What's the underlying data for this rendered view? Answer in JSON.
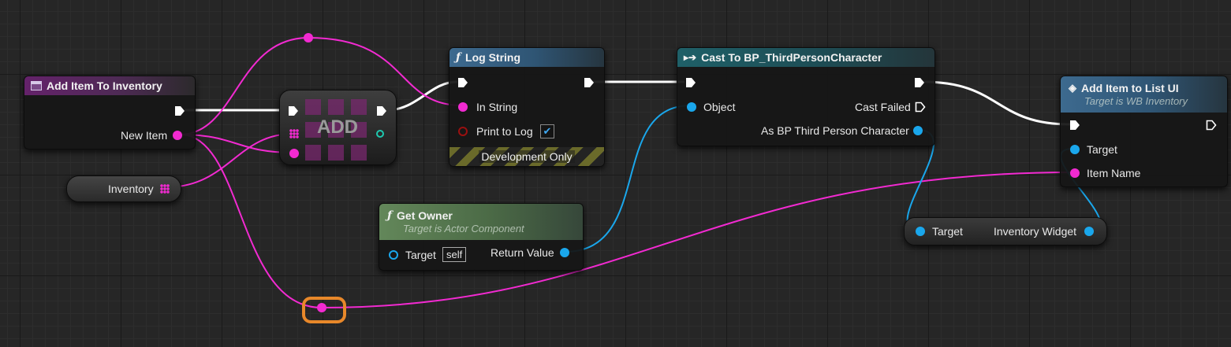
{
  "nodes": {
    "add_item_to_inventory": {
      "title": "Add Item To Inventory",
      "new_item_label": "New Item"
    },
    "inventory_var": {
      "label": "Inventory"
    },
    "add_op": {
      "label": "ADD"
    },
    "log_string": {
      "title": "Log String",
      "in_string_label": "In String",
      "print_to_log_label": "Print to Log",
      "print_to_log_checked": true,
      "footer": "Development Only"
    },
    "get_owner": {
      "title": "Get Owner",
      "subtitle": "Target is Actor Component",
      "target_label": "Target",
      "target_default": "self",
      "return_label": "Return Value"
    },
    "cast": {
      "title": "Cast To BP_ThirdPersonCharacter",
      "object_label": "Object",
      "cast_failed_label": "Cast Failed",
      "as_label": "As BP Third Person Character"
    },
    "add_item_to_list_ui": {
      "title": "Add Item to List UI",
      "subtitle": "Target is WB Inventory",
      "target_label": "Target",
      "item_name_label": "Item Name"
    },
    "inventory_widget_getter": {
      "target_label": "Target",
      "output_label": "Inventory Widget"
    }
  },
  "colors": {
    "exec_wire": "#ffffff",
    "string_wire": "#f22ad1",
    "object_wire": "#1aa7ec",
    "reroute": "#e8882a",
    "header_function": "#3d6a8f",
    "header_event": "#64226a",
    "header_cast": "#1f6068",
    "header_pure": "#63875a"
  },
  "icons": {
    "function": "function-f-icon",
    "event": "event-box-icon",
    "cast": "cast-arrows-icon",
    "message": "message-diamond-icon",
    "array": "array-grid-icon",
    "checkbox": "checkmark-icon"
  }
}
